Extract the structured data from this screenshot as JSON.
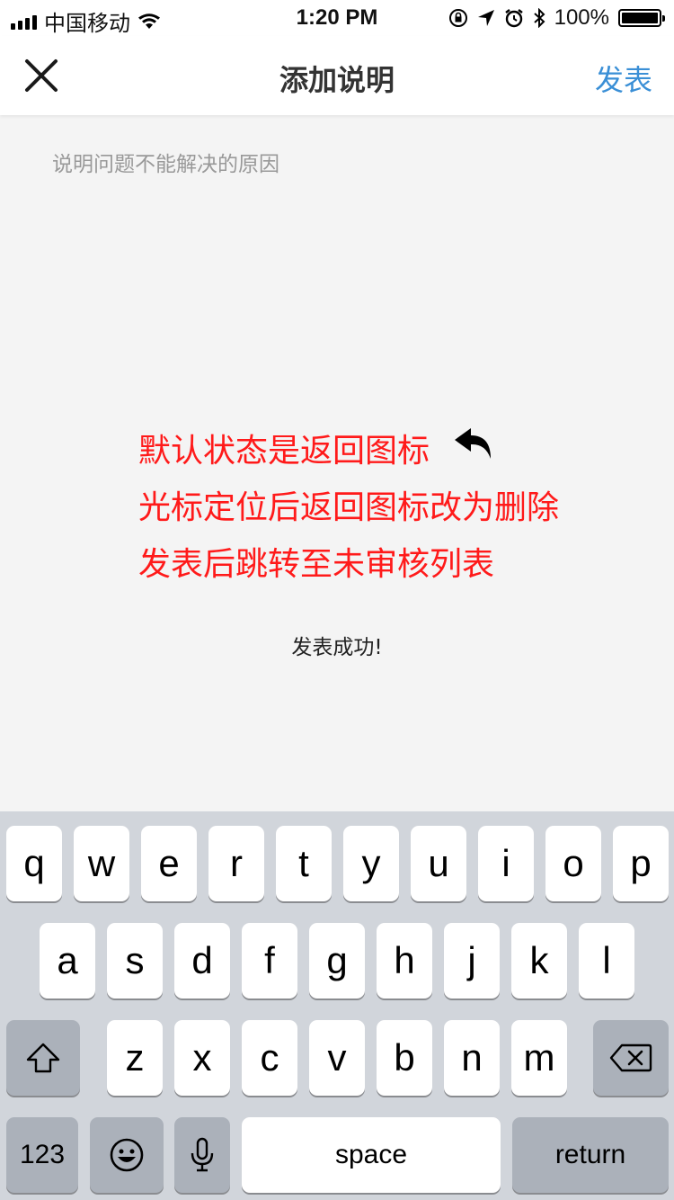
{
  "status": {
    "carrier": "中国移动",
    "time": "1:20 PM",
    "battery": "100%"
  },
  "nav": {
    "title": "添加说明",
    "publish": "发表"
  },
  "input": {
    "placeholder": "说明问题不能解决的原因"
  },
  "notes": [
    "默认状态是返回图标",
    "光标定位后返回图标改为删除",
    "发表后跳转至未审核列表"
  ],
  "toast": "发表成功!",
  "keyboard": {
    "row1": [
      "q",
      "w",
      "e",
      "r",
      "t",
      "y",
      "u",
      "i",
      "o",
      "p"
    ],
    "row2": [
      "a",
      "s",
      "d",
      "f",
      "g",
      "h",
      "j",
      "k",
      "l"
    ],
    "row3": [
      "z",
      "x",
      "c",
      "v",
      "b",
      "n",
      "m"
    ],
    "numbers_key": "123",
    "space_key": "space",
    "return_key": "return"
  }
}
